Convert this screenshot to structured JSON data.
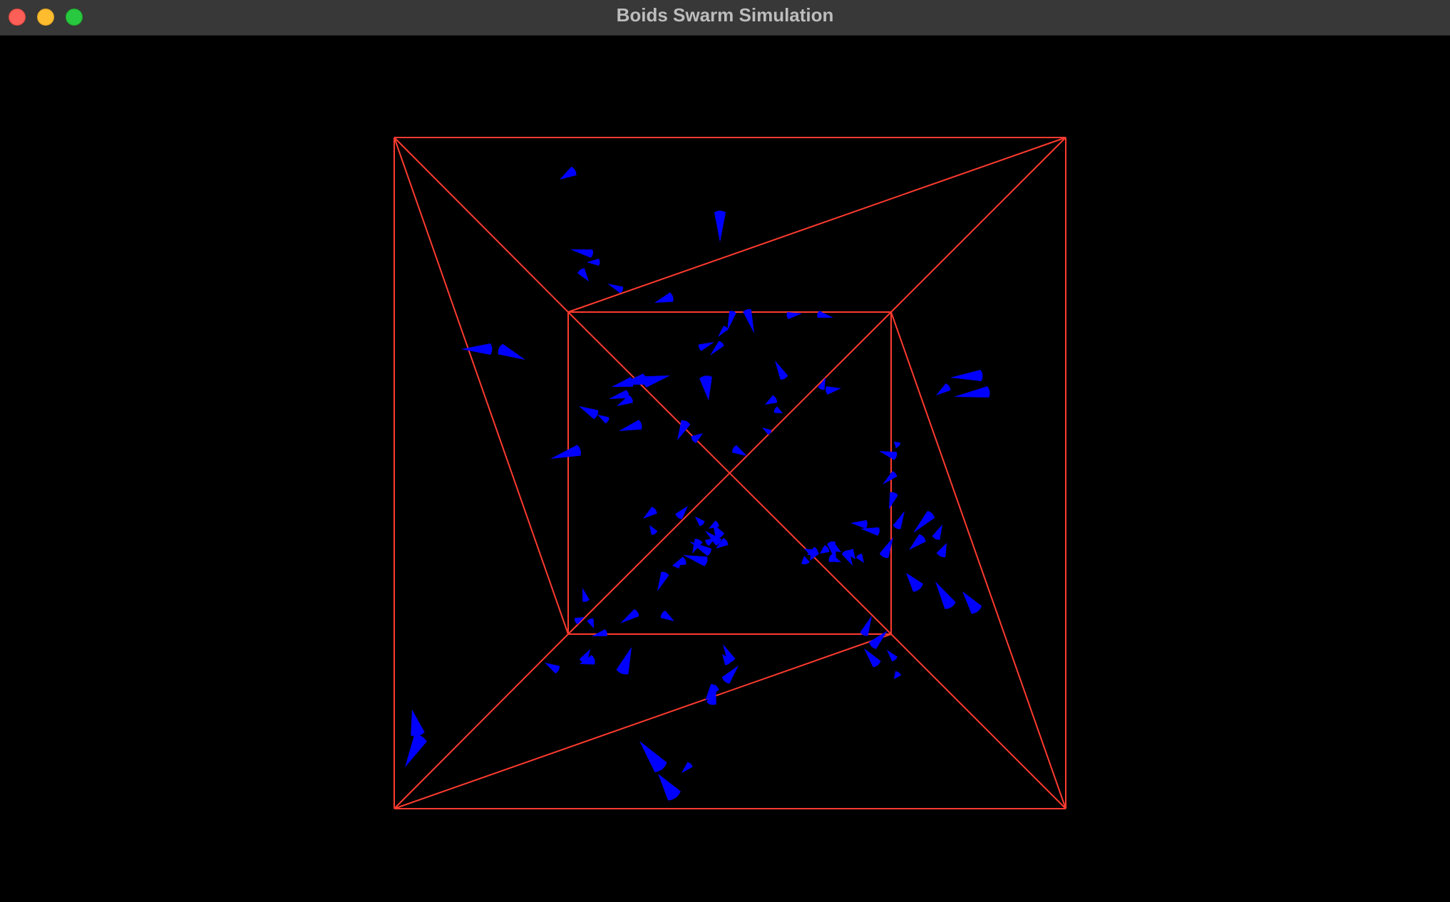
{
  "window": {
    "title": "Boids Swarm Simulation",
    "controls": [
      {
        "name": "close-button",
        "icon": "close-dot",
        "color": "#fe5f57"
      },
      {
        "name": "minimize-button",
        "icon": "minimize-dot",
        "color": "#febc2e"
      },
      {
        "name": "zoom-button",
        "icon": "zoom-dot",
        "color": "#28c840"
      }
    ]
  },
  "scene": {
    "background_color": "#000000",
    "boundary_color": "#ff3b30",
    "boid_color": "#0000ff",
    "boundary": "wireframe cube viewed in perspective",
    "boid_shape": "cone"
  }
}
